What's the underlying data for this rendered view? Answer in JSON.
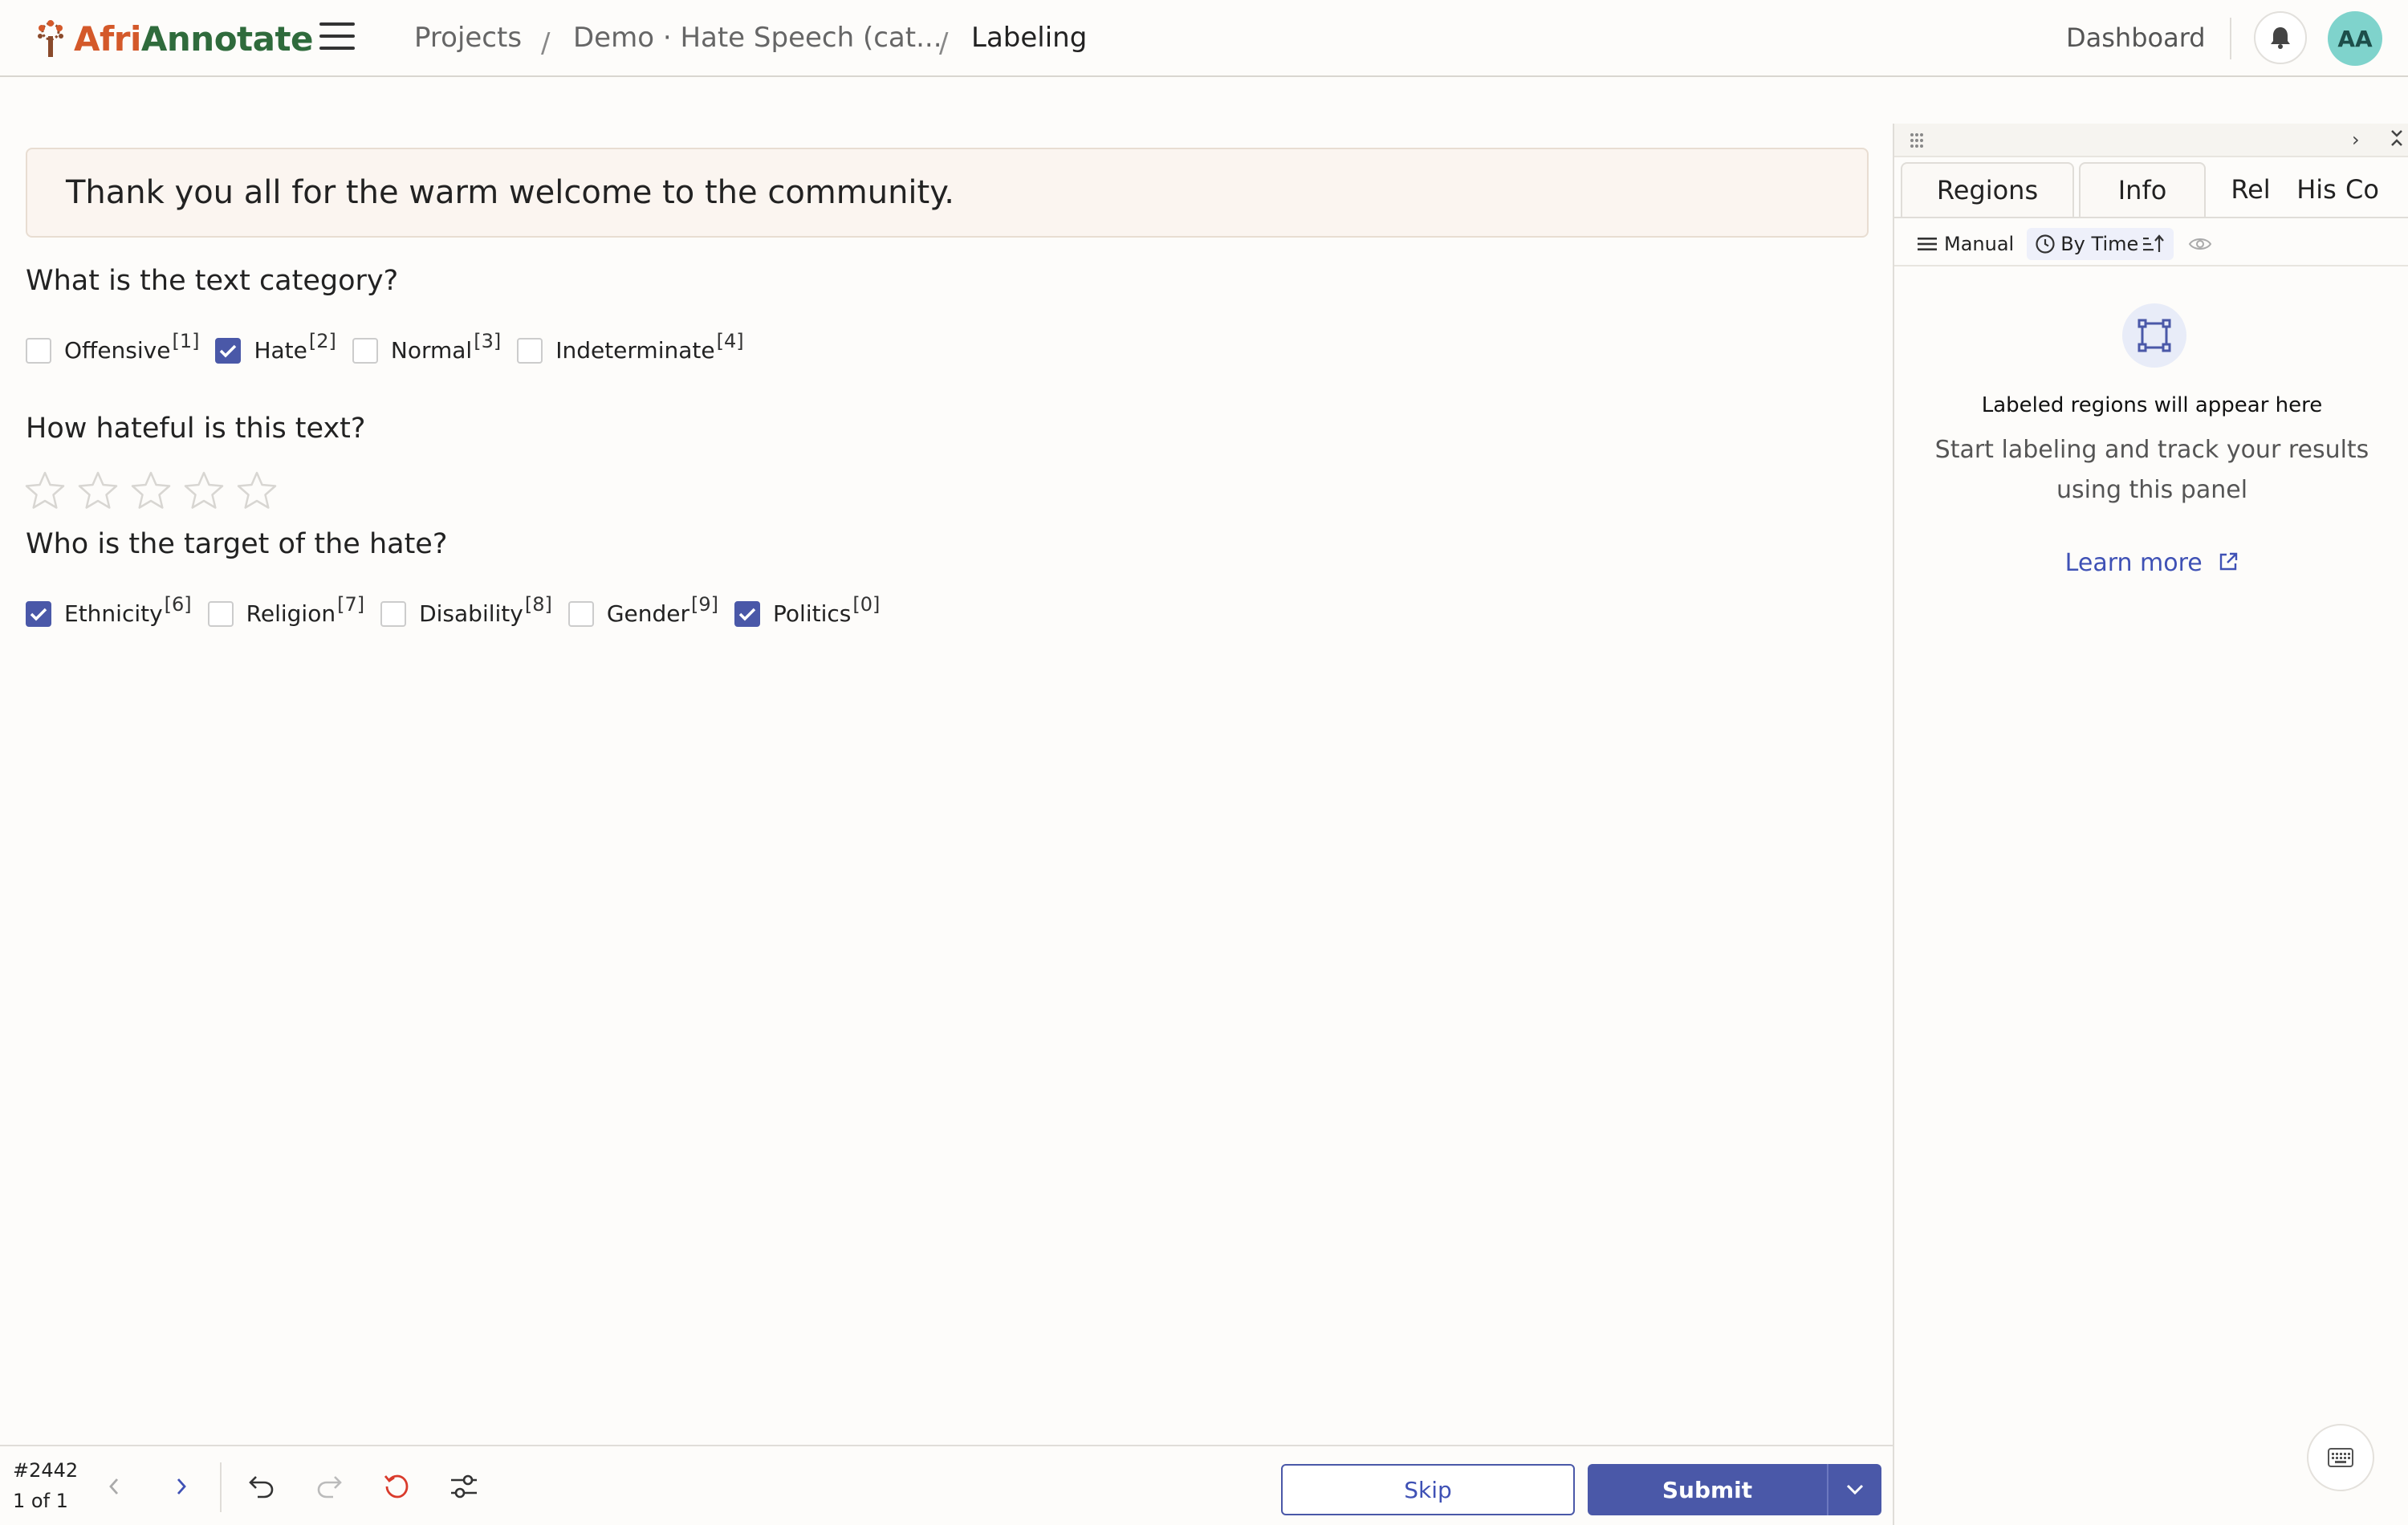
{
  "app": {
    "logo_part1": "Afri",
    "logo_part2": "Annotate",
    "brand_orange": "#d4592a",
    "brand_green": "#2f6b3c",
    "accent": "#4a58a8"
  },
  "breadcrumb": {
    "projects": "Projects",
    "project": "Demo · Hate Speech (cat...",
    "current": "Labeling",
    "separator": "/"
  },
  "header": {
    "dashboard": "Dashboard",
    "avatar_initials": "AA",
    "bell_icon": "bell-icon"
  },
  "task": {
    "text": "Thank you all for the warm welcome to the community."
  },
  "questions": [
    {
      "title": "What is the text category?",
      "choices": [
        {
          "label": "Offensive",
          "hotkey": "[1]",
          "checked": false
        },
        {
          "label": "Hate",
          "hotkey": "[2]",
          "checked": true
        },
        {
          "label": "Normal",
          "hotkey": "[3]",
          "checked": false
        },
        {
          "label": "Indeterminate",
          "hotkey": "[4]",
          "checked": false
        }
      ]
    },
    {
      "title": "How hateful is this text?",
      "rating": {
        "max": 5,
        "value": 0
      }
    },
    {
      "title": "Who is the target of the hate?",
      "choices": [
        {
          "label": "Ethnicity",
          "hotkey": "[6]",
          "checked": true
        },
        {
          "label": "Religion",
          "hotkey": "[7]",
          "checked": false
        },
        {
          "label": "Disability",
          "hotkey": "[8]",
          "checked": false
        },
        {
          "label": "Gender",
          "hotkey": "[9]",
          "checked": false
        },
        {
          "label": "Politics",
          "hotkey": "[0]",
          "checked": true
        }
      ]
    }
  ],
  "panel": {
    "tabs": [
      "Regions",
      "Info",
      "Rel",
      "His",
      "Co"
    ],
    "sort_manual": "Manual",
    "sort_time": "By Time",
    "empty_title": "Labeled regions will appear here",
    "empty_desc": "Start labeling and track your results using this panel",
    "learn_more": "Learn more"
  },
  "footer": {
    "task_id": "#2442",
    "task_count": "1 of 1",
    "skip": "Skip",
    "submit": "Submit"
  }
}
